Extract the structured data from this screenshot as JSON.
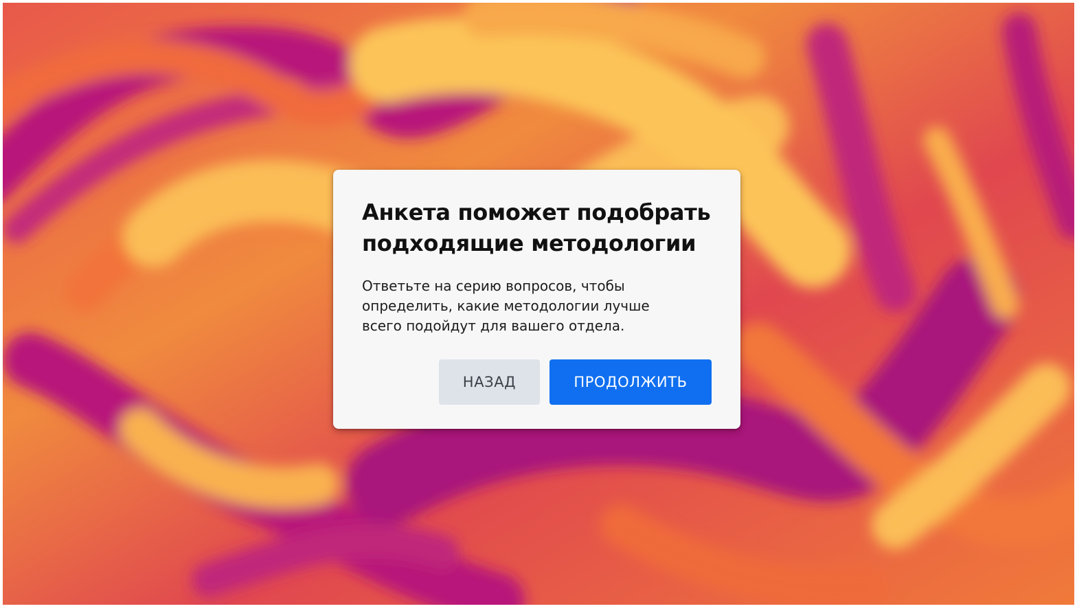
{
  "dialog": {
    "title": "Анкета поможет подобрать подходящие методологии",
    "body": "Ответьте на серию вопросов, чтобы определить, какие методологии лучше всего подойдут для вашего отдела.",
    "back_label": "НАЗАД",
    "continue_label": "ПРОДОЛЖИТЬ"
  },
  "colors": {
    "primary_button": "#0f6ff0",
    "secondary_button": "#dee3ea",
    "dialog_background": "#f7f7f7",
    "backdrop_magenta": "#b8197a",
    "backdrop_orange": "#f26a3a",
    "backdrop_yellow": "#fbbd56"
  },
  "icons": {
    "cursor": "mouse-pointer-icon"
  }
}
